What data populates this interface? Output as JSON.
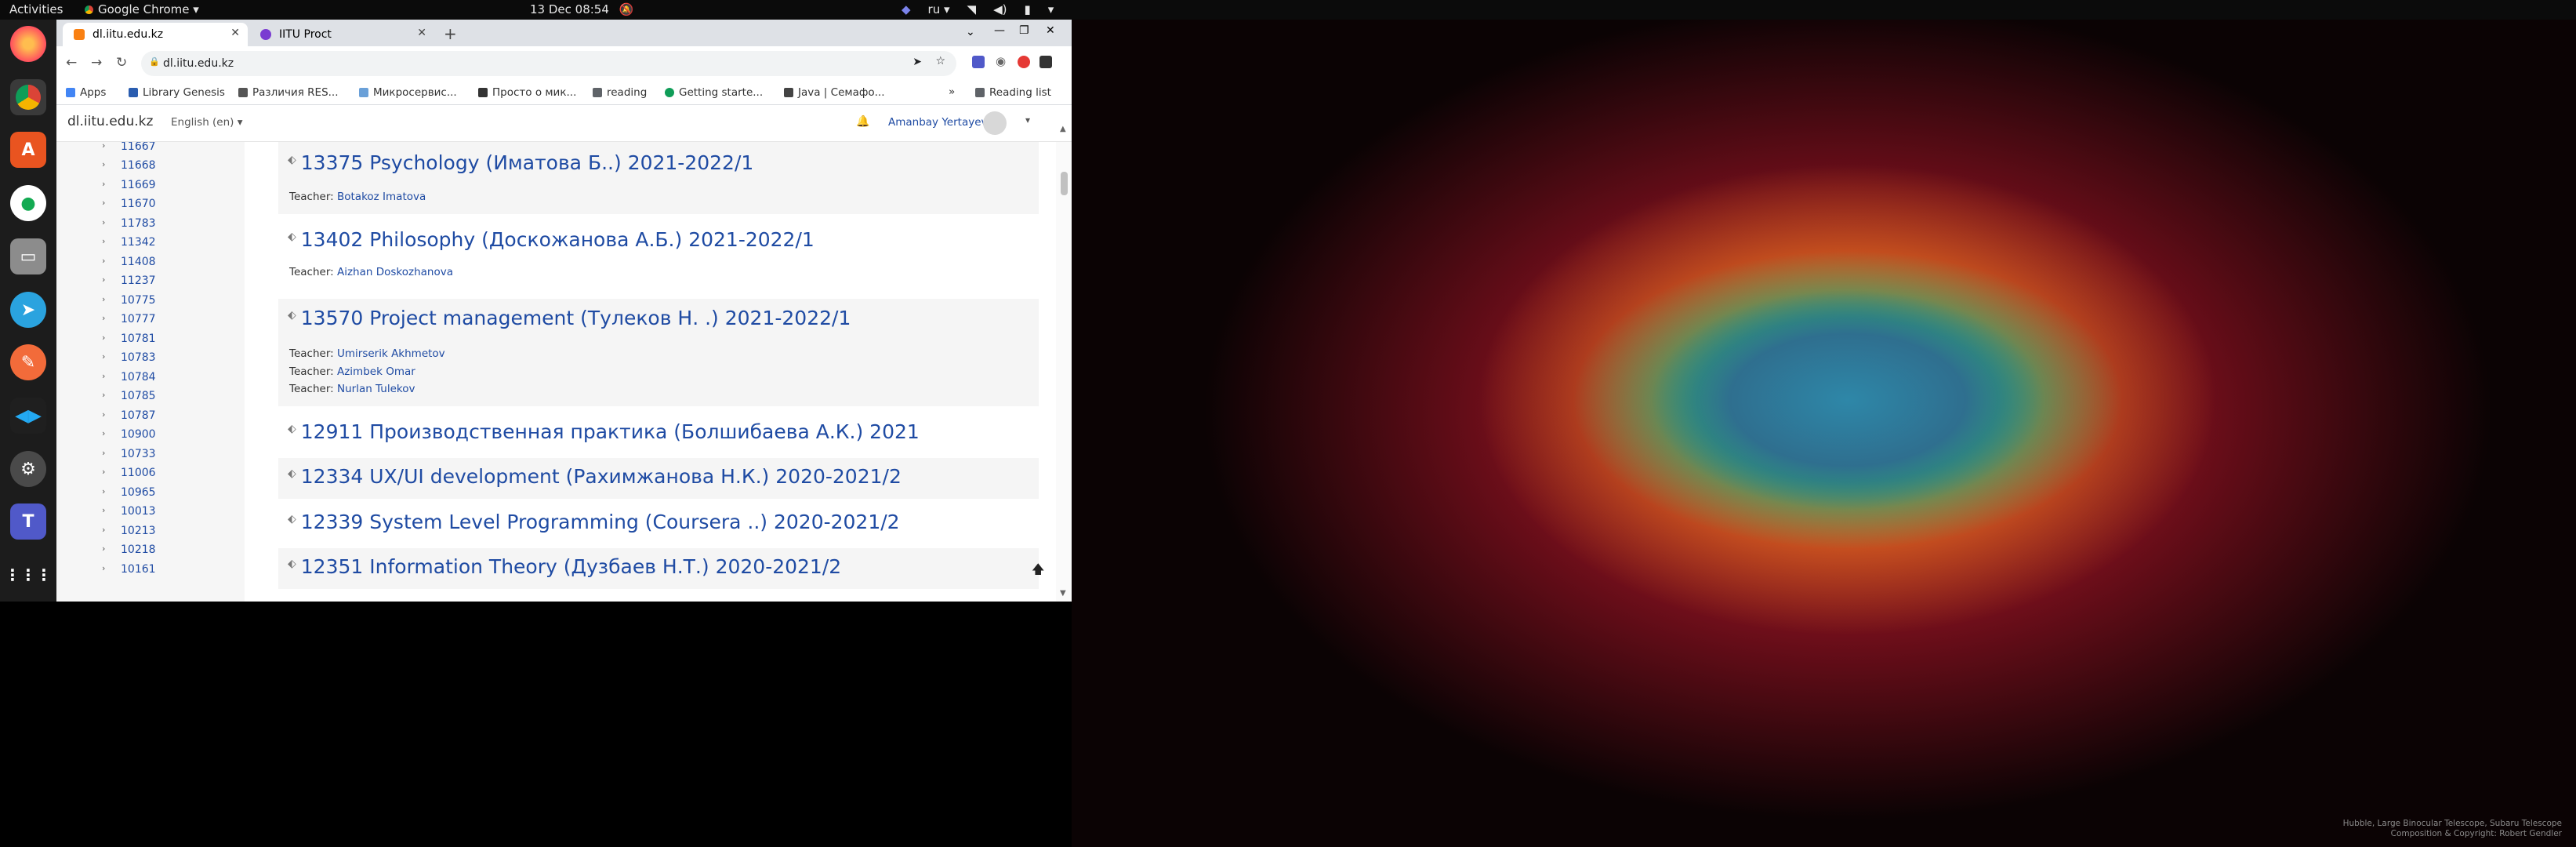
{
  "topbar": {
    "activities": "Activities",
    "app_menu": "Google Chrome ▾",
    "clock": "13 Dec  08:54",
    "lang": "ru ▾"
  },
  "browser": {
    "tabs": [
      {
        "label": "dl.iitu.edu.kz",
        "active": true
      },
      {
        "label": "IITU Proct",
        "active": false
      }
    ],
    "url": "dl.iitu.edu.kz",
    "bookmarks": [
      "Apps",
      "Library Genesis",
      "Различия RES...",
      "Микросервис...",
      "Просто о мик...",
      "reading",
      "Getting starte...",
      "Java | Семафо..."
    ],
    "reading_list": "Reading list"
  },
  "site": {
    "brand": "dl.iitu.edu.kz",
    "language": "English (en) ▾",
    "user": "Amanbay Yertayev"
  },
  "drawer": {
    "items": [
      "11667",
      "11668",
      "11669",
      "11670",
      "11783",
      "11342",
      "11408",
      "11237",
      "10775",
      "10777",
      "10781",
      "10783",
      "10784",
      "10785",
      "10787",
      "10900",
      "10733",
      "11006",
      "10965",
      "10013",
      "10213",
      "10218",
      "10161"
    ]
  },
  "courses": [
    {
      "title": "13375 Psychology (Иматова Б..) 2021-2022/1",
      "teacher_label": "Teacher:",
      "teachers": [
        "Botakoz Imatova"
      ]
    },
    {
      "title": "13402 Philosophy (Доскожанова А.Б.) 2021-2022/1",
      "teacher_label": "Teacher:",
      "teachers": [
        "Aizhan Doskozhanova"
      ]
    },
    {
      "title": "13570 Project management (Тулеков Н. .) 2021-2022/1",
      "teacher_label": "Teacher:",
      "teachers": [
        "Umirserik Akhmetov",
        "Azimbek Omar",
        "Nurlan Tulekov"
      ]
    },
    {
      "title": "12911 Производственная практика (Болшибаева А.К.) 2021",
      "teachers": []
    },
    {
      "title": "12334 UX/UI development (Рахимжанова Н.К.) 2020-2021/2",
      "teachers": []
    },
    {
      "title": "12339 System Level Programming (Coursera ..) 2020-2021/2",
      "teachers": []
    },
    {
      "title": "12351 Information Theory (Дузбаев Н.Т.) 2020-2021/2",
      "teachers": []
    }
  ],
  "wallpaper": {
    "credit_line1": "Hubble, Large Binocular Telescope, Subaru Telescope",
    "credit_line2": "Composition & Copyright: Robert Gendler"
  }
}
